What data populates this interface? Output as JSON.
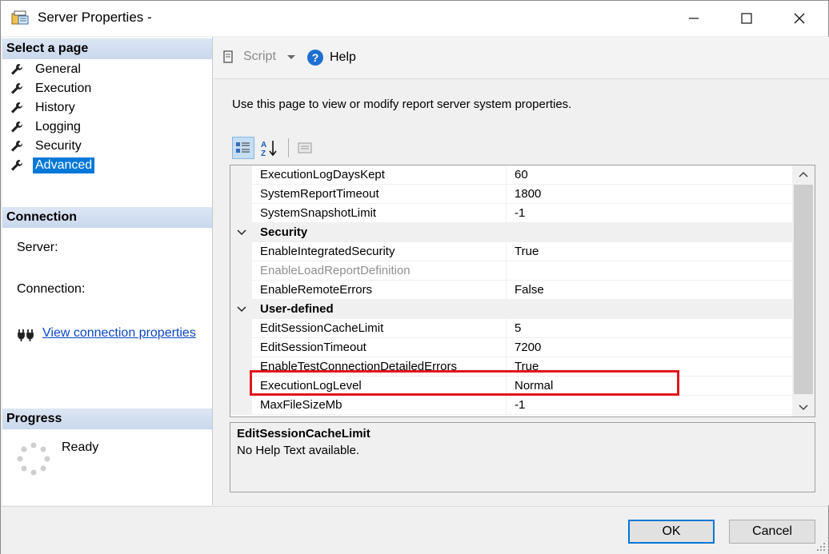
{
  "window": {
    "title": "Server Properties -"
  },
  "left": {
    "select_page_header": "Select a page",
    "pages": [
      {
        "label": "General"
      },
      {
        "label": "Execution"
      },
      {
        "label": "History"
      },
      {
        "label": "Logging"
      },
      {
        "label": "Security"
      },
      {
        "label": "Advanced"
      }
    ],
    "selected_page": "Advanced",
    "connection_header": "Connection",
    "server_label": "Server:",
    "connection_label": "Connection:",
    "view_connection_link": "View connection properties",
    "progress_header": "Progress",
    "progress_status": "Ready"
  },
  "toolbar": {
    "script_label": "Script",
    "help_label": "Help"
  },
  "description": "Use this page to view or modify report server system properties.",
  "property_grid": {
    "rows": [
      {
        "kind": "prop",
        "name": "ExecutionLogDaysKept",
        "value": "60"
      },
      {
        "kind": "prop",
        "name": "SystemReportTimeout",
        "value": "1800"
      },
      {
        "kind": "prop",
        "name": "SystemSnapshotLimit",
        "value": "-1"
      },
      {
        "kind": "category",
        "name": "Security"
      },
      {
        "kind": "prop",
        "name": "EnableIntegratedSecurity",
        "value": "True"
      },
      {
        "kind": "prop",
        "name": "EnableLoadReportDefinition",
        "value": "",
        "disabled": true
      },
      {
        "kind": "prop",
        "name": "EnableRemoteErrors",
        "value": "False"
      },
      {
        "kind": "category",
        "name": "User-defined"
      },
      {
        "kind": "prop",
        "name": "EditSessionCacheLimit",
        "value": "5"
      },
      {
        "kind": "prop",
        "name": "EditSessionTimeout",
        "value": "7200"
      },
      {
        "kind": "prop",
        "name": "EnableTestConnectionDetailedErrors",
        "value": "True"
      },
      {
        "kind": "prop",
        "name": "ExecutionLogLevel",
        "value": "Normal"
      },
      {
        "kind": "prop",
        "name": "MaxFileSizeMb",
        "value": "-1"
      }
    ],
    "highlighted_property": "ExecutionLogLevel"
  },
  "help_panel": {
    "title": "EditSessionCacheLimit",
    "text": "No Help Text available."
  },
  "buttons": {
    "ok": "OK",
    "cancel": "Cancel"
  },
  "colors": {
    "selection": "#0078d7",
    "highlight_border": "#e0161c",
    "header_gradient": "#c9d8ed"
  }
}
